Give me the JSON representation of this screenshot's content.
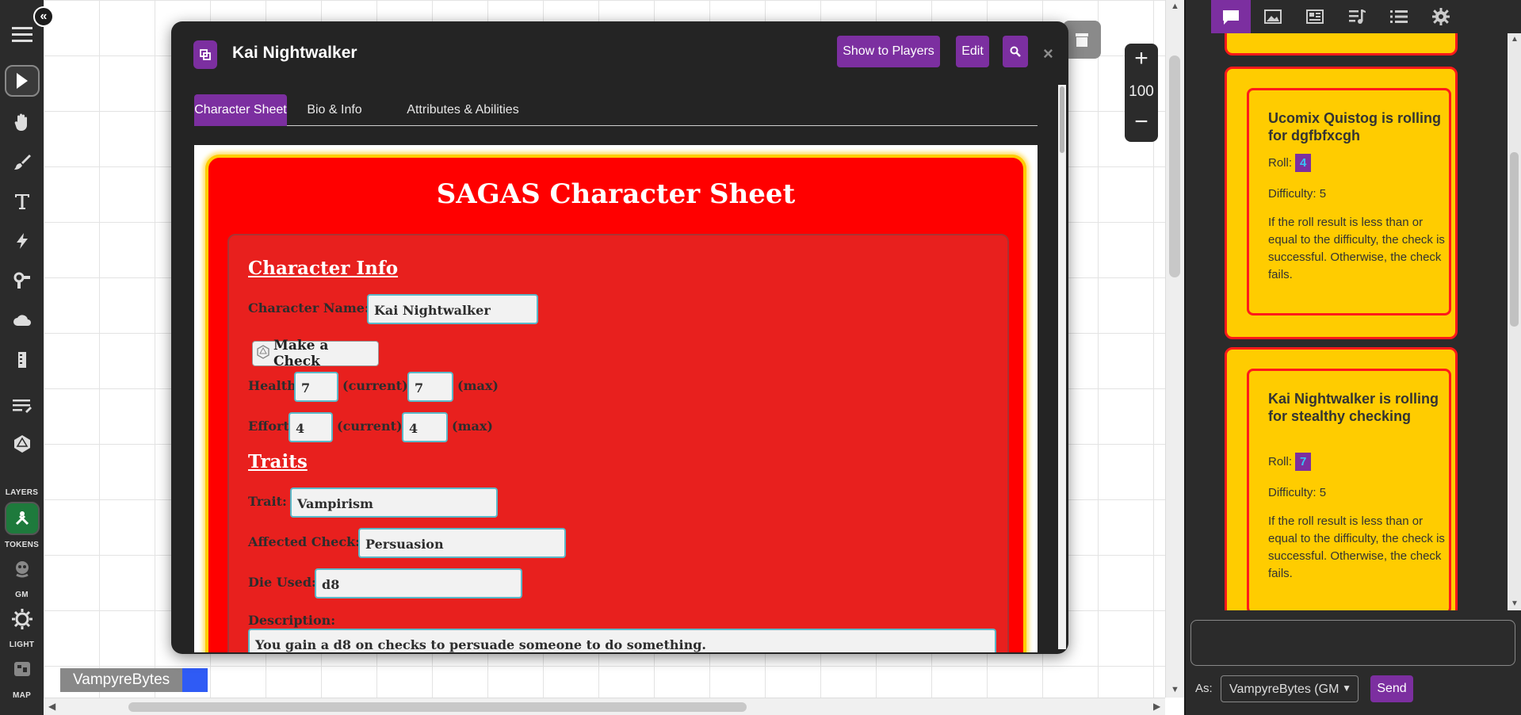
{
  "dialog": {
    "title": "Kai Nightwalker",
    "buttons": {
      "show_to_players": "Show to Players",
      "edit": "Edit"
    },
    "close": "×",
    "tabs": [
      "Character Sheet",
      "Bio & Info",
      "Attributes & Abilities"
    ],
    "active_tab": "Character Sheet"
  },
  "sheet": {
    "title": "SAGAS Character Sheet",
    "character_info": {
      "heading": "Character Info",
      "name_label": "Character Name:",
      "name_value": "Kai Nightwalker",
      "check_button": "Make a Check",
      "health_label": "Health:",
      "health_current": "7",
      "health_max": "7",
      "effort_label": "Effort:",
      "effort_current": "4",
      "effort_max": "4",
      "current_text": "(current) /",
      "max_text": "(max)"
    },
    "traits": {
      "heading": "Traits",
      "trait_label": "Trait:",
      "trait_value": "Vampirism",
      "affected_label": "Affected Check:",
      "affected_value": "Persuasion",
      "die_label": "Die Used:",
      "die_value": "d8",
      "description_label": "Description:",
      "description_value": "You gain a d8 on checks to persuade someone to do something."
    }
  },
  "toolbar": {
    "captions": {
      "layers": "LAYERS",
      "tokens": "TOKENS",
      "gm": "GM",
      "light": "LIGHT",
      "map": "MAP"
    }
  },
  "zoom": {
    "plus": "+",
    "value": "100",
    "minus": "−"
  },
  "player_tag": {
    "name": "VampyreBytes",
    "color": "#2f5bf5"
  },
  "chat": {
    "messages": [
      {
        "title": "Ucomix Quistog is rolling for dgfbfxcgh",
        "roll_label": "Roll:",
        "roll_value": "4",
        "difficulty": "Difficulty: 5",
        "description": "If the roll result is less than or equal to the difficulty, the check is successful. Otherwise, the check fails."
      },
      {
        "title": "Kai Nightwalker is rolling for stealthy checking",
        "roll_label": "Roll:",
        "roll_value": "7",
        "difficulty": "Difficulty: 5",
        "description": "If the roll result is less than or equal to the difficulty, the check is successful. Otherwise, the check fails."
      }
    ],
    "as_label": "As:",
    "as_value": "VampyreBytes (GM",
    "send": "Send"
  },
  "colors": {
    "accent": "#7c2fa0",
    "sheet_red": "#ff0000",
    "card_yellow": "#ffcc00"
  }
}
